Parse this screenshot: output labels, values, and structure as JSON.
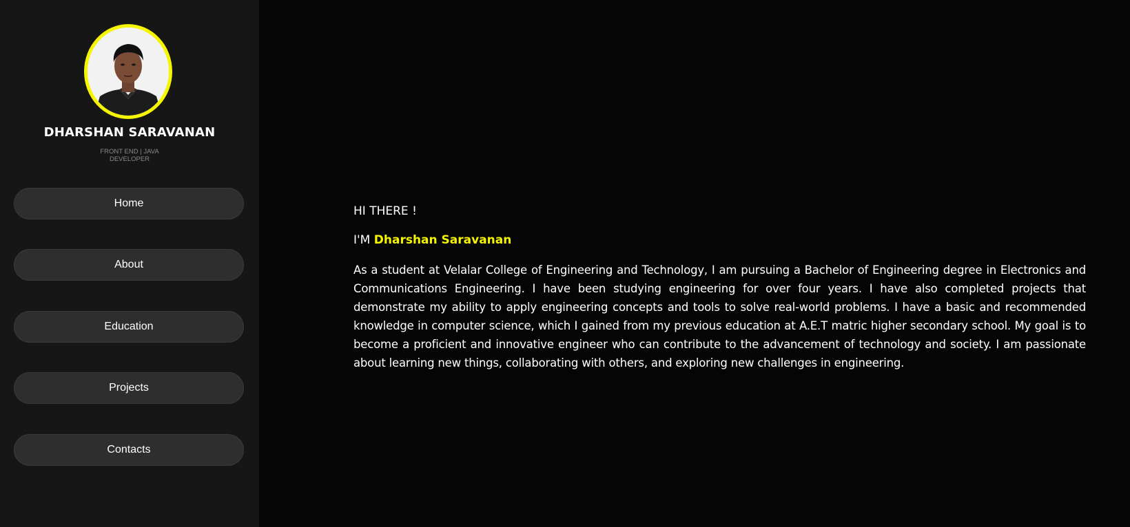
{
  "profile": {
    "name": "DHARSHAN SARAVANAN",
    "role": "FRONT END | JAVA DEVELOPER"
  },
  "nav": {
    "items": [
      {
        "label": "Home"
      },
      {
        "label": "About"
      },
      {
        "label": "Education"
      },
      {
        "label": "Projects"
      },
      {
        "label": "Contacts"
      }
    ]
  },
  "main": {
    "greeting": "HI THERE !",
    "intro_prefix": "I'M ",
    "intro_name": "Dharshan Saravanan",
    "bio": "As a student at Velalar College of Engineering and Technology, I am pursuing a Bachelor of Engineering degree in Electronics and Communications Engineering. I have been studying engineering for over four years. I have also completed projects that demonstrate my ability to apply engineering concepts and tools to solve real-world problems. I have a basic and recommended knowledge in computer science, which I gained from my previous education at A.E.T matric higher secondary school. My goal is to become a proficient and innovative engineer who can contribute to the advancement of technology and society. I am passionate about learning new things, collaborating with others, and exploring new challenges in engineering."
  },
  "colors": {
    "accent": "#f5f500",
    "sidebar_bg": "#161616",
    "main_bg": "#050505",
    "nav_button_bg": "#2e2e2e"
  }
}
